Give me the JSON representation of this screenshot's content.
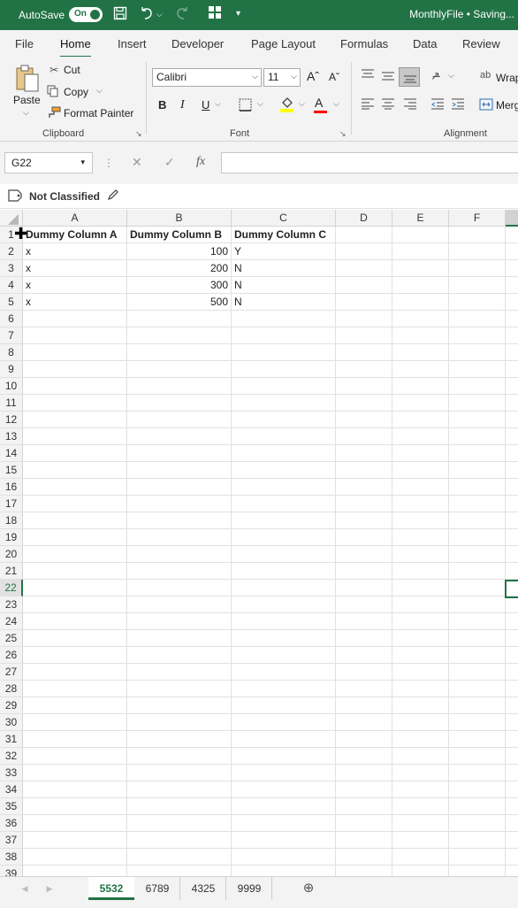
{
  "titlebar": {
    "autosave_label": "AutoSave",
    "autosave_state": "On",
    "filename": "MonthlyFile • Saving..."
  },
  "ribbon_tabs": [
    "File",
    "Home",
    "Insert",
    "Developer",
    "Page Layout",
    "Formulas",
    "Data",
    "Review"
  ],
  "active_tab": "Home",
  "clipboard": {
    "paste": "Paste",
    "cut": "Cut",
    "copy": "Copy",
    "format_painter": "Format Painter",
    "group_label": "Clipboard"
  },
  "font": {
    "name": "Calibri",
    "size": "11",
    "group_label": "Font",
    "bold": "B",
    "italic": "I",
    "underline": "U",
    "grow": "Aˆ",
    "shrink": "Aˇ",
    "font_color_letter": "A",
    "highlight_color": "#ffff00",
    "font_color": "#ff0000"
  },
  "alignment": {
    "wrap": "Wrap",
    "merge": "Merg",
    "group_label": "Alignment"
  },
  "formula_bar": {
    "name_box": "G22",
    "fx": "fx",
    "value": ""
  },
  "classification": {
    "label": "Not Classified"
  },
  "columns": [
    "A",
    "B",
    "C",
    "D",
    "E",
    "F"
  ],
  "rows": {
    "count": 39,
    "selected_row": 22
  },
  "table": {
    "headers": [
      "Dummy Column A",
      "Dummy Column B",
      "Dummy Column C"
    ],
    "data": [
      [
        "x",
        "100",
        "Y"
      ],
      [
        "x",
        "200",
        "N"
      ],
      [
        "x",
        "300",
        "N"
      ],
      [
        "x",
        "500",
        "N"
      ]
    ]
  },
  "sheets": [
    "5532",
    "6789",
    "4325",
    "9999"
  ],
  "active_sheet": "5532",
  "colors": {
    "accent": "#217346"
  }
}
